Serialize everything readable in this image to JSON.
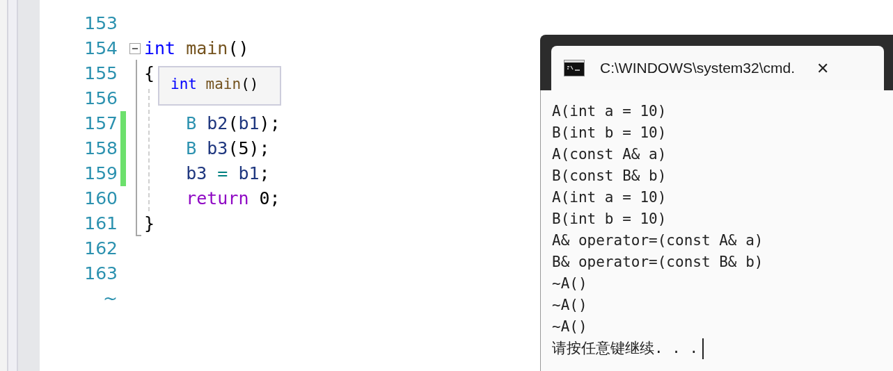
{
  "editor": {
    "lines": [
      {
        "number": "153",
        "changed": false
      },
      {
        "number": "154",
        "changed": false,
        "tokens": [
          {
            "text": "int",
            "kind": "keyword"
          },
          {
            "text": " main",
            "kind": "function"
          },
          {
            "text": "()",
            "kind": "plain"
          }
        ]
      },
      {
        "number": "155",
        "changed": false,
        "tokens": [
          {
            "text": "{",
            "kind": "plain"
          }
        ]
      },
      {
        "number": "156",
        "changed": false
      },
      {
        "number": "157",
        "changed": true,
        "tokens": [
          {
            "text": "    B",
            "kind": "type"
          },
          {
            "text": " b2",
            "kind": "variable"
          },
          {
            "text": "(",
            "kind": "plain"
          },
          {
            "text": "b1",
            "kind": "variable"
          },
          {
            "text": ");",
            "kind": "plain"
          }
        ]
      },
      {
        "number": "158",
        "changed": true,
        "tokens": [
          {
            "text": "    B",
            "kind": "type"
          },
          {
            "text": " b3",
            "kind": "variable"
          },
          {
            "text": "(5);",
            "kind": "plain"
          }
        ]
      },
      {
        "number": "159",
        "changed": true,
        "tokens": [
          {
            "text": "    b3",
            "kind": "variable"
          },
          {
            "text": " =",
            "kind": "operator"
          },
          {
            "text": " b1",
            "kind": "variable"
          },
          {
            "text": ";",
            "kind": "plain"
          }
        ]
      },
      {
        "number": "160",
        "changed": false,
        "tokens": [
          {
            "text": "    return",
            "kind": "control"
          },
          {
            "text": " 0;",
            "kind": "plain"
          }
        ]
      },
      {
        "number": "161",
        "changed": false,
        "tokens": [
          {
            "text": "}",
            "kind": "plain"
          }
        ]
      },
      {
        "number": "162",
        "changed": false
      },
      {
        "number": "163",
        "changed": false
      }
    ],
    "end_marker": "~",
    "fold_region": {
      "expanded": true
    },
    "tooltip": [
      {
        "text": "int",
        "kind": "keyword"
      },
      {
        "text": " main",
        "kind": "function"
      },
      {
        "text": "()",
        "kind": "plain"
      }
    ]
  },
  "console": {
    "title": "C:\\WINDOWS\\system32\\cmd.",
    "close": "✕",
    "lines": [
      "A(int a = 10)",
      "B(int b = 10)",
      "A(const A& a)",
      "B(const B& b)",
      "A(int a = 10)",
      "B(int b = 10)",
      "A& operator=(const A& a)",
      "B& operator=(const B& b)",
      "~A()",
      "~A()",
      "~A()",
      "请按任意键继续. . ."
    ]
  }
}
